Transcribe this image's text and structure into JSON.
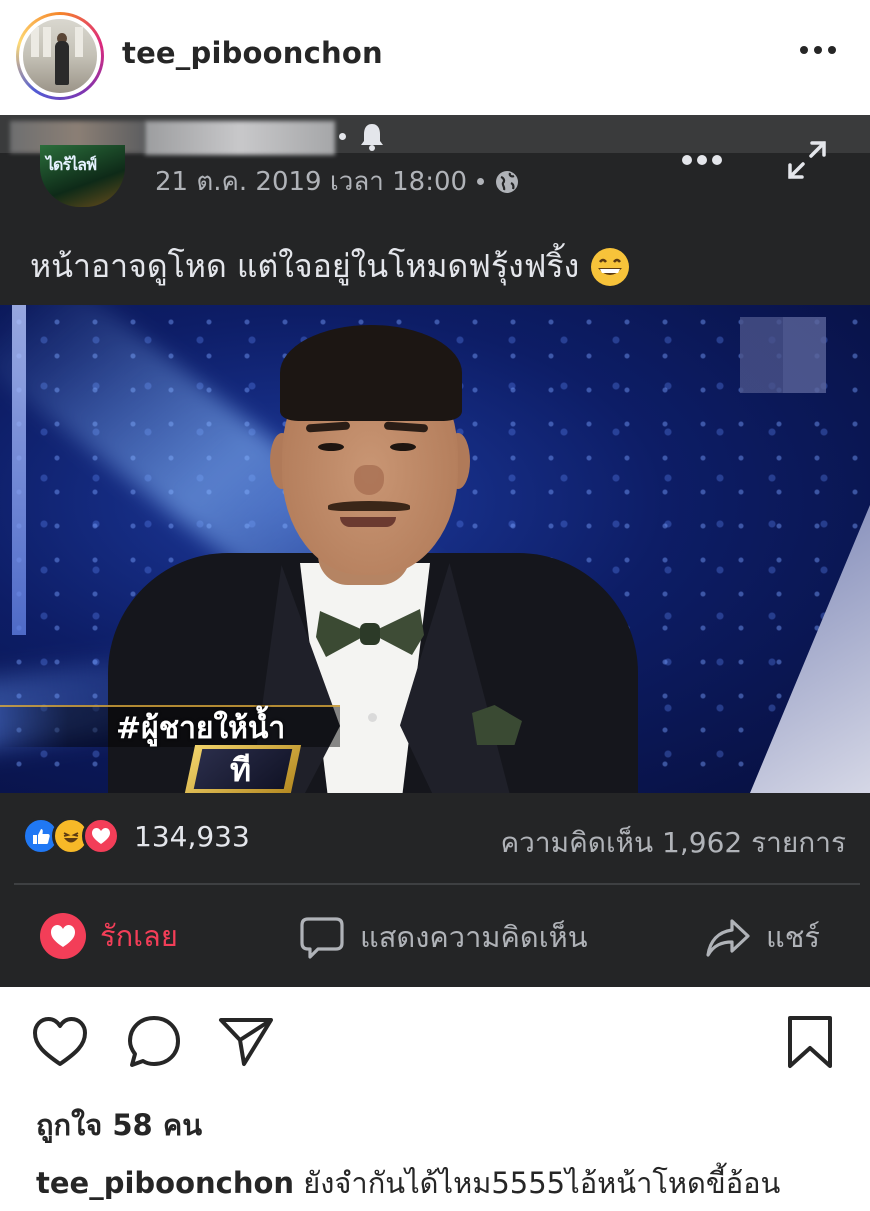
{
  "post": {
    "username": "tee_piboonchon",
    "more_icon": "more-horizontal-icon",
    "avatar": "profile-avatar"
  },
  "fb_post": {
    "date": "21 ต.ค. 2019 เวลา 18:00",
    "privacy_icon": "globe-icon",
    "caption": "หน้าอาจดูโหด แต่ใจอยู่ในโหมดฟรุ้งฟริ้ง",
    "caption_emoji": "grinning-emoji",
    "logo_text": "ไดร้ไลฟ์",
    "photo": {
      "hashtag": "#ผู้ชายให้น้ำ",
      "tag_box": "ที"
    },
    "reactions_count": "134,933",
    "comments_count": "ความคิดเห็น 1,962 รายการ",
    "actions": {
      "love": "รักเลย",
      "comment": "แสดงความคิดเห็น",
      "share": "แชร์"
    },
    "colors": {
      "background": "#242526",
      "text_secondary": "#b0b3b8",
      "like": "#2078f4",
      "haha": "#f7b928",
      "love": "#f33e58"
    }
  },
  "ig_footer": {
    "likes": "ถูกใจ 58 คน",
    "caption_user": "tee_piboonchon",
    "caption_text": " ยังจำกันได้ไหม5555ไอ้หน้าโหดขี้อ้อน"
  }
}
